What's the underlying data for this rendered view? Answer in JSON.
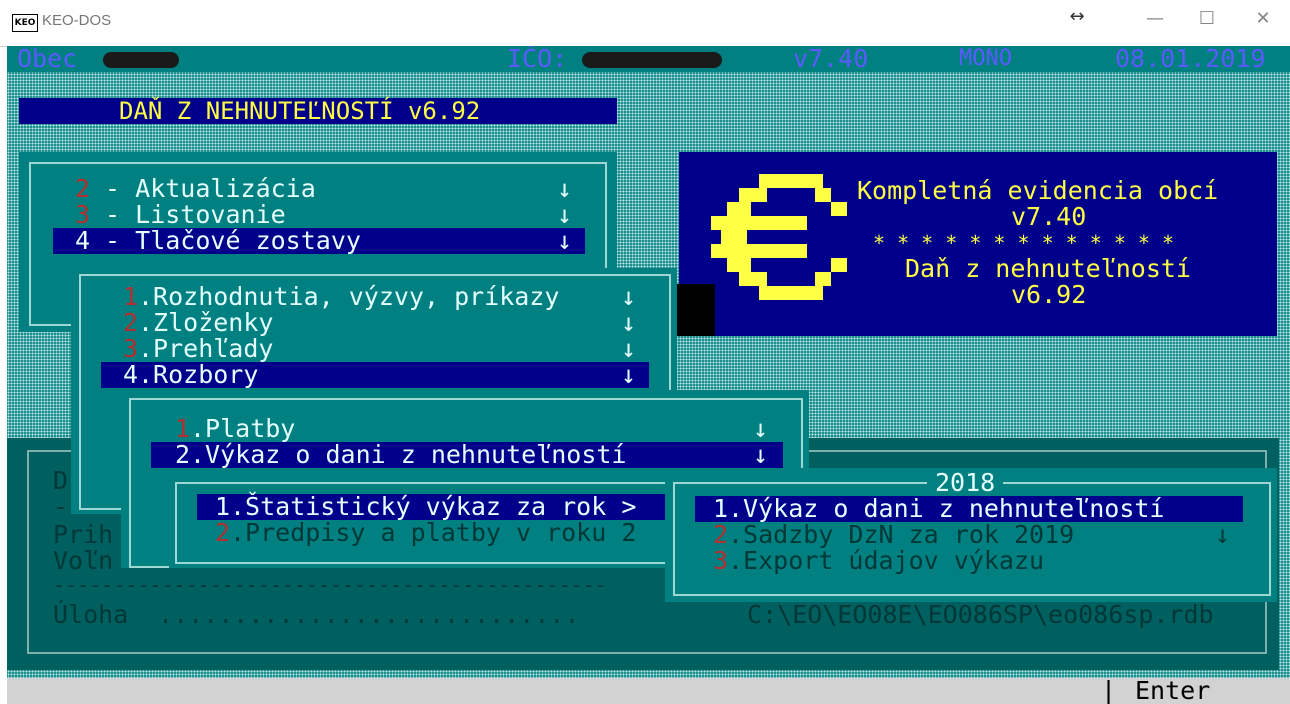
{
  "window": {
    "title": "KEO-DOS",
    "icon_text": "KEO",
    "ctrl_resize": "↔",
    "ctrl_min": "—",
    "ctrl_max": "☐",
    "ctrl_close": "✕"
  },
  "status": {
    "obec_label": "Obec",
    "ico_label": "IČO:",
    "version": "v7.40",
    "mode": "MONO",
    "date": "08.01.2019"
  },
  "app_title": "DAŇ Z NEHNUTEĽNOSTÍ v6.92",
  "menu1": {
    "items": [
      {
        "num": "2",
        "label": " - Aktualizácia"
      },
      {
        "num": "3",
        "label": " - Listovanie"
      },
      {
        "num": "4",
        "label": " - Tlačové zostavy"
      }
    ]
  },
  "menu2": {
    "items": [
      {
        "num": "1",
        "label": ".Rozhodnutia, výzvy, príkazy"
      },
      {
        "num": "2",
        "label": ".Zloženky"
      },
      {
        "num": "3",
        "label": ".Prehľady"
      },
      {
        "num": "4",
        "label": ".Rozbory"
      }
    ]
  },
  "menu3": {
    "items": [
      {
        "num": "1",
        "label": ".Platby"
      },
      {
        "num": "2",
        "label": ".Výkaz o dani z nehnuteľností"
      }
    ]
  },
  "menu4": {
    "items": [
      {
        "num": "1",
        "label": ".Štatistický výkaz za rok >"
      },
      {
        "num": "2",
        "label": ".Predpisy a platby v roku 2"
      }
    ]
  },
  "menu5": {
    "title": "2018",
    "items": [
      {
        "num": "1",
        "label": ".Výkaz o dani z nehnuteľností"
      },
      {
        "num": "2",
        "label": ".Sadzby DzN za rok 2019"
      },
      {
        "num": "3",
        "label": ".Export údajov výkazu"
      }
    ]
  },
  "arrow": "↓",
  "info": {
    "line1": "Kompletná evidencia obcí",
    "line2": "v7.40",
    "stars": "* * * * * * * * * * * * *",
    "line3": "Daň z nehnuteľností",
    "line4": "v6.92"
  },
  "bg_panel": {
    "d": "D",
    "dash": "-",
    "prih": "Prih",
    "voln": "Voľn",
    "sep": "----------------------------------------------"
  },
  "uloha": {
    "label": "Úloha",
    "dots": " ............................",
    "path": "C:\\EO\\EO08E\\EO086SP\\eo086sp.rdb"
  },
  "bottom": {
    "divider": "|",
    "enter": "Enter"
  }
}
